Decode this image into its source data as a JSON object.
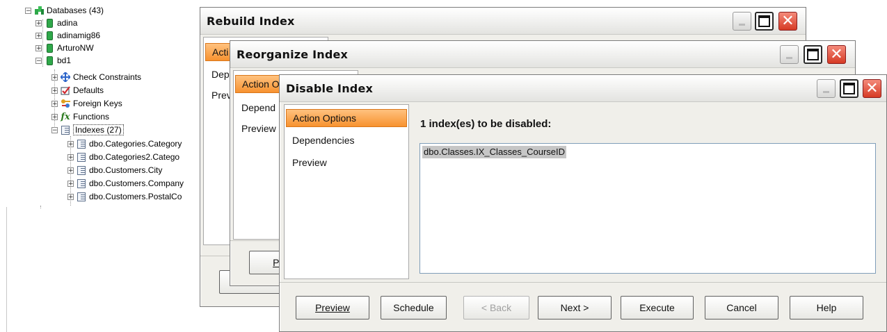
{
  "tree": {
    "root": {
      "label": "Databases (43)"
    },
    "databases": [
      {
        "label": "adina"
      },
      {
        "label": "adinamig86"
      },
      {
        "label": "ArturoNW"
      },
      {
        "label": "bd1"
      }
    ],
    "bd1_children": [
      {
        "label": "Check Constraints",
        "icon": "check-constraints-icon"
      },
      {
        "label": "Defaults",
        "icon": "defaults-icon"
      },
      {
        "label": "Foreign Keys",
        "icon": "foreign-keys-icon"
      },
      {
        "label": "Functions",
        "icon": "functions-icon"
      },
      {
        "label": "Indexes (27)",
        "icon": "indexes-icon"
      }
    ],
    "indexes": [
      {
        "label": "dbo.Categories.Category"
      },
      {
        "label": "dbo.Categories2.Catego"
      },
      {
        "label": "dbo.Customers.City"
      },
      {
        "label": "dbo.Customers.Company"
      },
      {
        "label": "dbo.Customers.PostalCo"
      }
    ]
  },
  "rebuild_window": {
    "title": "Rebuild Index",
    "nav": [
      "Acti",
      "Dep",
      "Prev"
    ]
  },
  "reorganize_window": {
    "title": "Reorganize Index",
    "nav": [
      "Action O",
      "Depend",
      "Preview"
    ],
    "preview_button": "Pre"
  },
  "disable_window": {
    "title": "Disable Index",
    "nav": [
      "Action Options",
      "Dependencies",
      "Preview"
    ],
    "heading": "1 index(es) to be disabled:",
    "list_items": [
      "dbo.Classes.IX_Classes_CourseID"
    ],
    "buttons": {
      "preview": "Preview",
      "schedule": "Schedule",
      "back": "< Back",
      "next": "Next >",
      "execute": "Execute",
      "cancel": "Cancel",
      "help": "Help"
    }
  },
  "colors": {
    "active_nav": "#f7922f",
    "close_button": "#d63a24",
    "tree_db_icon": "#2fa84a"
  }
}
